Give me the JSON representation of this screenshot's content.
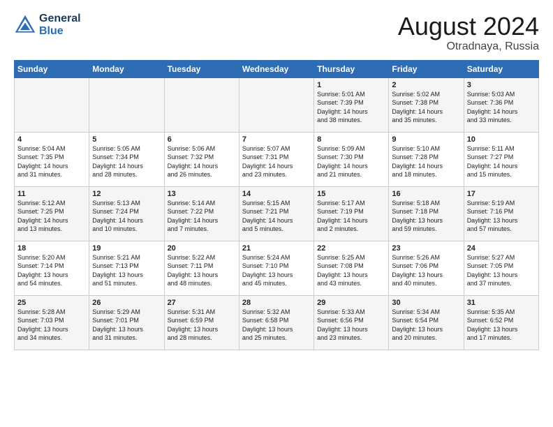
{
  "logo": {
    "line1": "General",
    "line2": "Blue"
  },
  "title": "August 2024",
  "subtitle": "Otradnaya, Russia",
  "header": {
    "days": [
      "Sunday",
      "Monday",
      "Tuesday",
      "Wednesday",
      "Thursday",
      "Friday",
      "Saturday"
    ]
  },
  "weeks": [
    {
      "cells": [
        {
          "day": "",
          "content": ""
        },
        {
          "day": "",
          "content": ""
        },
        {
          "day": "",
          "content": ""
        },
        {
          "day": "",
          "content": ""
        },
        {
          "day": "1",
          "content": "Sunrise: 5:01 AM\nSunset: 7:39 PM\nDaylight: 14 hours\nand 38 minutes."
        },
        {
          "day": "2",
          "content": "Sunrise: 5:02 AM\nSunset: 7:38 PM\nDaylight: 14 hours\nand 35 minutes."
        },
        {
          "day": "3",
          "content": "Sunrise: 5:03 AM\nSunset: 7:36 PM\nDaylight: 14 hours\nand 33 minutes."
        }
      ]
    },
    {
      "cells": [
        {
          "day": "4",
          "content": "Sunrise: 5:04 AM\nSunset: 7:35 PM\nDaylight: 14 hours\nand 31 minutes."
        },
        {
          "day": "5",
          "content": "Sunrise: 5:05 AM\nSunset: 7:34 PM\nDaylight: 14 hours\nand 28 minutes."
        },
        {
          "day": "6",
          "content": "Sunrise: 5:06 AM\nSunset: 7:32 PM\nDaylight: 14 hours\nand 26 minutes."
        },
        {
          "day": "7",
          "content": "Sunrise: 5:07 AM\nSunset: 7:31 PM\nDaylight: 14 hours\nand 23 minutes."
        },
        {
          "day": "8",
          "content": "Sunrise: 5:09 AM\nSunset: 7:30 PM\nDaylight: 14 hours\nand 21 minutes."
        },
        {
          "day": "9",
          "content": "Sunrise: 5:10 AM\nSunset: 7:28 PM\nDaylight: 14 hours\nand 18 minutes."
        },
        {
          "day": "10",
          "content": "Sunrise: 5:11 AM\nSunset: 7:27 PM\nDaylight: 14 hours\nand 15 minutes."
        }
      ]
    },
    {
      "cells": [
        {
          "day": "11",
          "content": "Sunrise: 5:12 AM\nSunset: 7:25 PM\nDaylight: 14 hours\nand 13 minutes."
        },
        {
          "day": "12",
          "content": "Sunrise: 5:13 AM\nSunset: 7:24 PM\nDaylight: 14 hours\nand 10 minutes."
        },
        {
          "day": "13",
          "content": "Sunrise: 5:14 AM\nSunset: 7:22 PM\nDaylight: 14 hours\nand 7 minutes."
        },
        {
          "day": "14",
          "content": "Sunrise: 5:15 AM\nSunset: 7:21 PM\nDaylight: 14 hours\nand 5 minutes."
        },
        {
          "day": "15",
          "content": "Sunrise: 5:17 AM\nSunset: 7:19 PM\nDaylight: 14 hours\nand 2 minutes."
        },
        {
          "day": "16",
          "content": "Sunrise: 5:18 AM\nSunset: 7:18 PM\nDaylight: 13 hours\nand 59 minutes."
        },
        {
          "day": "17",
          "content": "Sunrise: 5:19 AM\nSunset: 7:16 PM\nDaylight: 13 hours\nand 57 minutes."
        }
      ]
    },
    {
      "cells": [
        {
          "day": "18",
          "content": "Sunrise: 5:20 AM\nSunset: 7:14 PM\nDaylight: 13 hours\nand 54 minutes."
        },
        {
          "day": "19",
          "content": "Sunrise: 5:21 AM\nSunset: 7:13 PM\nDaylight: 13 hours\nand 51 minutes."
        },
        {
          "day": "20",
          "content": "Sunrise: 5:22 AM\nSunset: 7:11 PM\nDaylight: 13 hours\nand 48 minutes."
        },
        {
          "day": "21",
          "content": "Sunrise: 5:24 AM\nSunset: 7:10 PM\nDaylight: 13 hours\nand 45 minutes."
        },
        {
          "day": "22",
          "content": "Sunrise: 5:25 AM\nSunset: 7:08 PM\nDaylight: 13 hours\nand 43 minutes."
        },
        {
          "day": "23",
          "content": "Sunrise: 5:26 AM\nSunset: 7:06 PM\nDaylight: 13 hours\nand 40 minutes."
        },
        {
          "day": "24",
          "content": "Sunrise: 5:27 AM\nSunset: 7:05 PM\nDaylight: 13 hours\nand 37 minutes."
        }
      ]
    },
    {
      "cells": [
        {
          "day": "25",
          "content": "Sunrise: 5:28 AM\nSunset: 7:03 PM\nDaylight: 13 hours\nand 34 minutes."
        },
        {
          "day": "26",
          "content": "Sunrise: 5:29 AM\nSunset: 7:01 PM\nDaylight: 13 hours\nand 31 minutes."
        },
        {
          "day": "27",
          "content": "Sunrise: 5:31 AM\nSunset: 6:59 PM\nDaylight: 13 hours\nand 28 minutes."
        },
        {
          "day": "28",
          "content": "Sunrise: 5:32 AM\nSunset: 6:58 PM\nDaylight: 13 hours\nand 25 minutes."
        },
        {
          "day": "29",
          "content": "Sunrise: 5:33 AM\nSunset: 6:56 PM\nDaylight: 13 hours\nand 23 minutes."
        },
        {
          "day": "30",
          "content": "Sunrise: 5:34 AM\nSunset: 6:54 PM\nDaylight: 13 hours\nand 20 minutes."
        },
        {
          "day": "31",
          "content": "Sunrise: 5:35 AM\nSunset: 6:52 PM\nDaylight: 13 hours\nand 17 minutes."
        }
      ]
    }
  ]
}
